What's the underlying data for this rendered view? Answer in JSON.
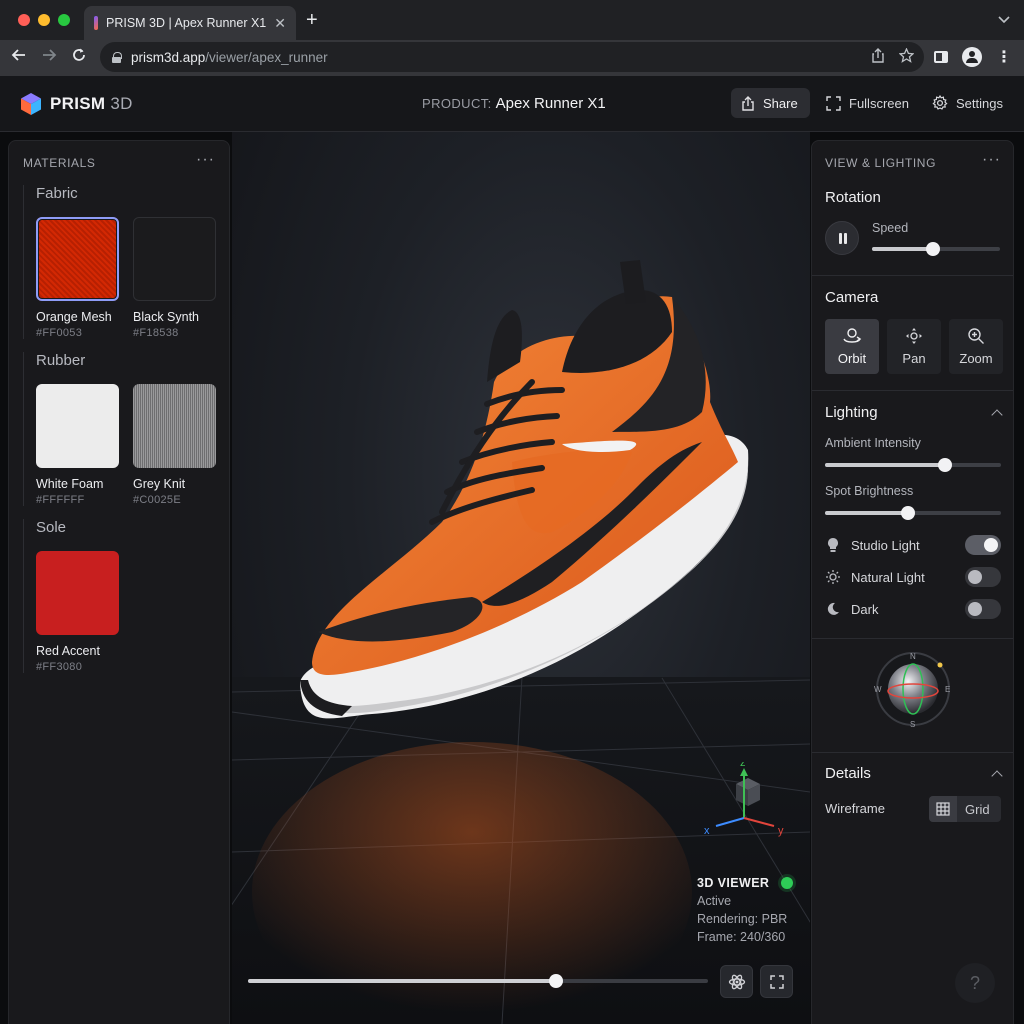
{
  "browser": {
    "tab_title": "PRISM 3D | Apex Runner X1",
    "tab_close": "✕",
    "new_tab": "+",
    "url_host": "prism3d.app",
    "url_path": "/viewer/apex_runner",
    "traffic_lights": [
      "#ff5f57",
      "#febc2e",
      "#28c840"
    ]
  },
  "header": {
    "logo_main": "PRISM",
    "logo_dim": "3D",
    "product_label": "PRODUCT:",
    "product_name": "Apex Runner X1",
    "share_label": "Share",
    "fullscreen_label": "Fullscreen",
    "settings_label": "Settings"
  },
  "materials": {
    "title": "MATERIALS",
    "more": "···",
    "groups": [
      {
        "title": "Fabric",
        "items": [
          {
            "name": "Orange Mesh",
            "hex": "#FF0053",
            "color": "#e8651c",
            "selected": true
          },
          {
            "name": "Black Synth",
            "hex": "#F18538",
            "color": "#1b1b1d",
            "selected": false
          }
        ]
      },
      {
        "title": "Rubber",
        "items": [
          {
            "name": "White Foam",
            "hex": "#FFFFFF",
            "color": "#ececec",
            "selected": false
          },
          {
            "name": "Grey Knit",
            "hex": "#C0025E",
            "color": "#8e8e90",
            "selected": false
          }
        ]
      },
      {
        "title": "Sole",
        "items": [
          {
            "name": "Red Accent",
            "hex": "#FF3080",
            "color": "#c81f1f",
            "selected": false
          }
        ]
      }
    ]
  },
  "viewer": {
    "axis_z": "z",
    "axis_x": "x",
    "axis_y": "y",
    "status_title": "3D VIEWER",
    "status_state": "Active",
    "status_render": "Rendering: PBR",
    "status_frame": "Frame: 240/360",
    "timeline_progress": 0.67
  },
  "view_lighting": {
    "title": "VIEW & LIGHTING",
    "more": "···",
    "rotation_title": "Rotation",
    "speed_label": "Speed",
    "speed_value": 0.48,
    "camera_title": "Camera",
    "camera_modes": [
      {
        "label": "Orbit",
        "active": true
      },
      {
        "label": "Pan",
        "active": false
      },
      {
        "label": "Zoom",
        "active": false
      }
    ],
    "lighting_title": "Lighting",
    "ambient_label": "Ambient Intensity",
    "ambient_value": 0.68,
    "spot_label": "Spot Brightness",
    "spot_value": 0.47,
    "lights": [
      {
        "name": "Studio Light",
        "on": true
      },
      {
        "name": "Natural Light",
        "on": false
      },
      {
        "name": "Dark",
        "on": false
      }
    ],
    "compass": {
      "n": "N",
      "s": "S",
      "e": "E",
      "w": "W"
    },
    "details_title": "Details",
    "wireframe_label": "Wireframe",
    "grid_label": "Grid",
    "help": "?"
  }
}
